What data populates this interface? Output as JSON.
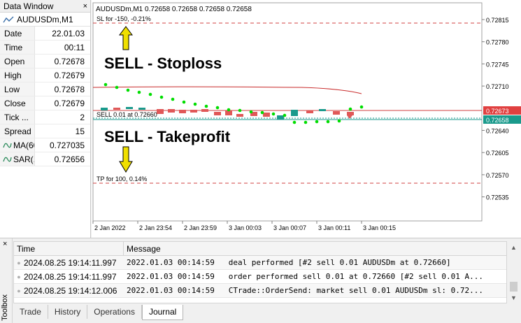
{
  "data_window": {
    "title": "Data Window",
    "close_glyph": "×",
    "symbol": "AUDUSDm,M1",
    "rows": [
      {
        "label": "Date",
        "value": "22.01.03"
      },
      {
        "label": "Time",
        "value": "00:11"
      },
      {
        "label": "Open",
        "value": "0.72678"
      },
      {
        "label": "High",
        "value": "0.72679"
      },
      {
        "label": "Low",
        "value": "0.72678"
      },
      {
        "label": "Close",
        "value": "0.72679"
      },
      {
        "label": "Tick ...",
        "value": "2"
      },
      {
        "label": "Spread",
        "value": "15"
      }
    ],
    "indicators": [
      {
        "label": "MA(60)",
        "value": "0.727035",
        "icon": "indicator-wave-icon"
      },
      {
        "label": "SAR(...",
        "value": "0.72656",
        "icon": "indicator-wave-icon"
      }
    ]
  },
  "chart": {
    "header": "AUDUSDm,M1  0.72658 0.72658 0.72658 0.72658",
    "sl_line_label": "SL for -150, -0.21%",
    "entry_line_label": "SELL 0.01 at 0.72660",
    "tp_line_label": "TP for 100, 0.14%",
    "annotation_sl": "SELL - Stoploss",
    "annotation_tp": "SELL - Takeprofit",
    "price_ticks": [
      "0.72815",
      "0.72780",
      "0.72745",
      "0.72710",
      "0.72640",
      "0.72605",
      "0.72570",
      "0.72535"
    ],
    "price_badges": [
      {
        "text": "0.72673",
        "color": "#e04040"
      },
      {
        "text": "0.72658",
        "color": "#1a9a8c"
      }
    ],
    "time_ticks": [
      "2 Jan 2022",
      "2 Jan 23:54",
      "2 Jan 23:59",
      "3 Jan 00:03",
      "3 Jan 00:07",
      "3 Jan 00:11",
      "3 Jan 00:15"
    ],
    "colors": {
      "sl_tp_line": "#d04040",
      "entry_line": "#1a9a8c",
      "ma": "#c82828",
      "sar": "#00dd00",
      "bear": "#e05858",
      "bull": "#1a9a8c",
      "arrow": "#f0e000"
    }
  },
  "toolbox": {
    "label": "Toolbox",
    "close_glyph": "×",
    "columns": {
      "time": "Time",
      "message": "Message"
    },
    "rows": [
      {
        "time": "2024.08.25 19:14:11.997",
        "message": "2022.01.03 00:14:59   deal performed [#2 sell 0.01 AUDUSDm at 0.72660]"
      },
      {
        "time": "2024.08.25 19:14:11.997",
        "message": "2022.01.03 00:14:59   order performed sell 0.01 at 0.72660 [#2 sell 0.01 A..."
      },
      {
        "time": "2024.08.25 19:14:12.006",
        "message": "2022.01.03 00:14:59   CTrade::OrderSend: market sell 0.01 AUDUSDm sl: 0.72..."
      }
    ],
    "tabs": [
      "Trade",
      "History",
      "Operations",
      "Journal"
    ],
    "active_tab": "Journal"
  }
}
